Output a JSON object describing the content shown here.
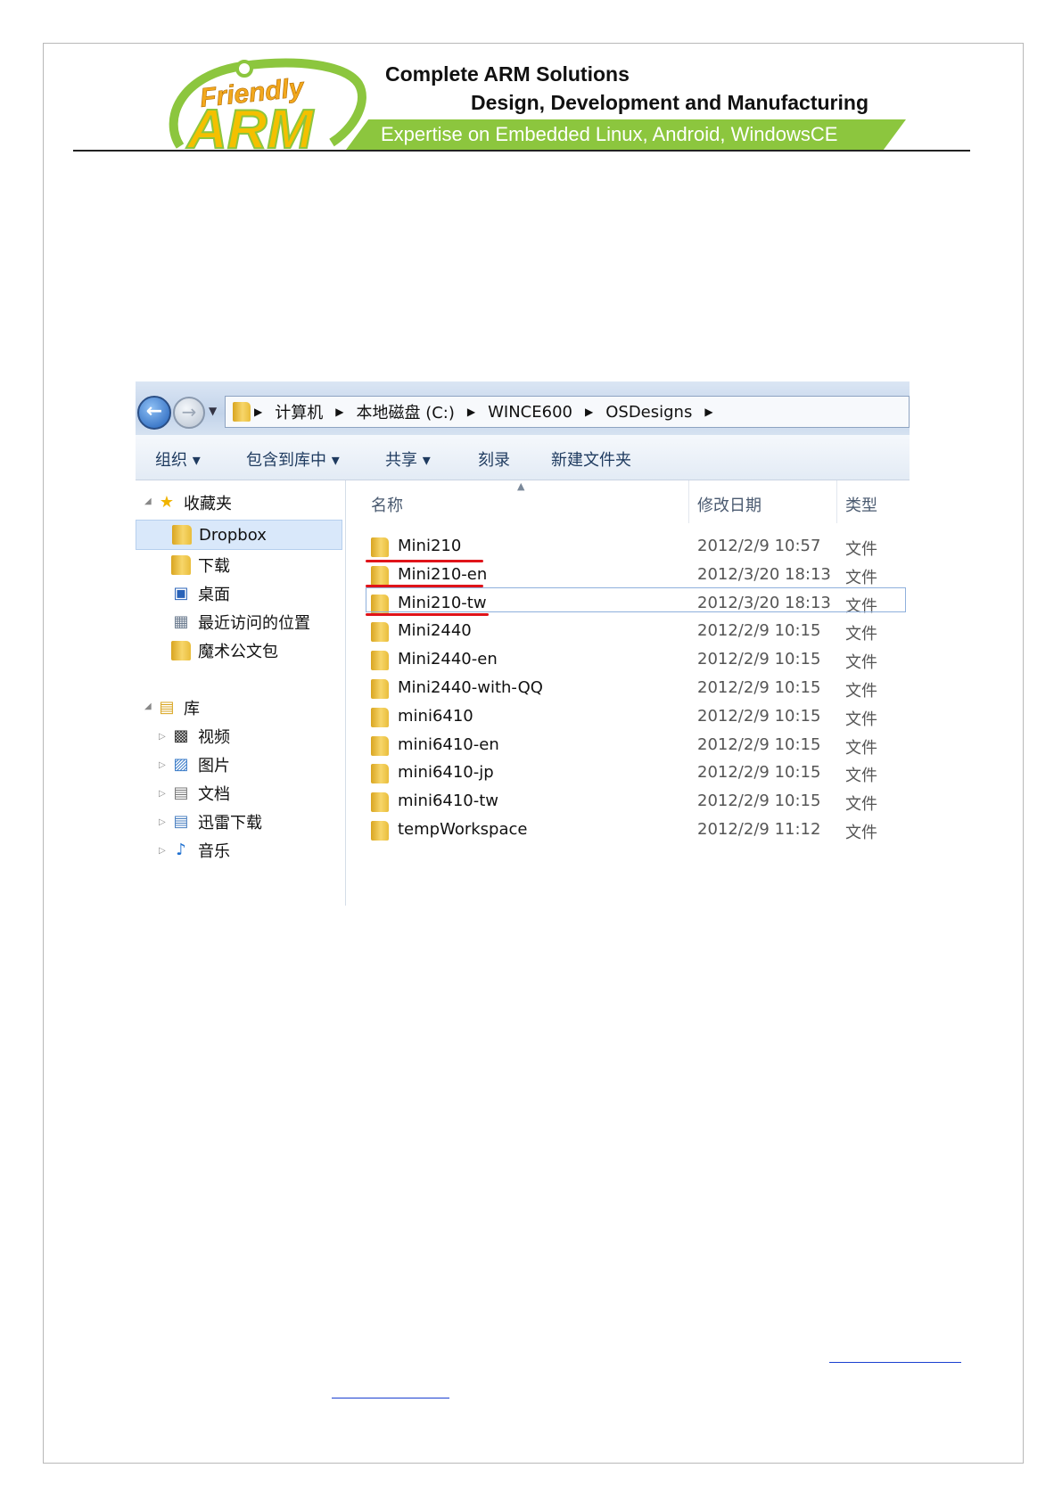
{
  "header": {
    "logo_text_top": "Friendly",
    "logo_text_bottom": "ARM",
    "tagline_1": "Complete ARM Solutions",
    "tagline_2": "Design, Development and  Manufacturing",
    "tagline_3": "Expertise on Embedded Linux, Android, WindowsCE"
  },
  "explorer": {
    "breadcrumbs": [
      "计算机",
      "本地磁盘 (C:)",
      "WINCE600",
      "OSDesigns"
    ],
    "toolbar": [
      "组织 ▾",
      "包含到库中 ▾",
      "共享 ▾",
      "刻录",
      "新建文件夹"
    ],
    "nav": {
      "favorites_label": "收藏夹",
      "favorites": [
        "Dropbox",
        "下载",
        "桌面",
        "最近访问的位置",
        "魔术公文包"
      ],
      "library_label": "库",
      "library": [
        "视频",
        "图片",
        "文档",
        "迅雷下载",
        "音乐"
      ]
    },
    "columns": {
      "name": "名称",
      "date": "修改日期",
      "type": "类型"
    },
    "files": [
      {
        "name": "Mini210",
        "date": "2012/2/9 10:57",
        "type": "文件"
      },
      {
        "name": "Mini210-en",
        "date": "2012/3/20 18:13",
        "type": "文件"
      },
      {
        "name": "Mini210-tw",
        "date": "2012/3/20 18:13",
        "type": "文件"
      },
      {
        "name": "Mini2440",
        "date": "2012/2/9 10:15",
        "type": "文件"
      },
      {
        "name": "Mini2440-en",
        "date": "2012/2/9 10:15",
        "type": "文件"
      },
      {
        "name": "Mini2440-with-QQ",
        "date": "2012/2/9 10:15",
        "type": "文件"
      },
      {
        "name": "mini6410",
        "date": "2012/2/9 10:15",
        "type": "文件"
      },
      {
        "name": "mini6410-en",
        "date": "2012/2/9 10:15",
        "type": "文件"
      },
      {
        "name": "mini6410-jp",
        "date": "2012/2/9 10:15",
        "type": "文件"
      },
      {
        "name": "mini6410-tw",
        "date": "2012/2/9 10:15",
        "type": "文件"
      },
      {
        "name": "tempWorkspace",
        "date": "2012/2/9 11:12",
        "type": "文件"
      }
    ]
  }
}
